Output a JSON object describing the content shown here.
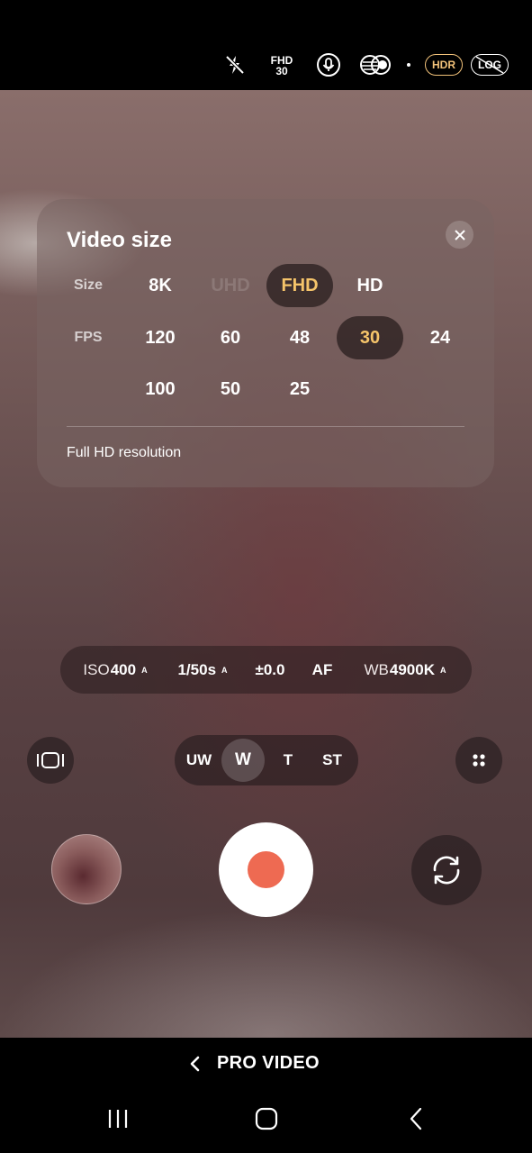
{
  "status_bar": {
    "flash_icon": "flash-off-icon",
    "resolution_badge": {
      "size": "FHD",
      "fps": "30"
    },
    "mic_icon": "microphone-icon",
    "filter_icon": "filter-icon",
    "hdr_label": "HDR",
    "log_label": "LOG"
  },
  "video_size_panel": {
    "title": "Video size",
    "size_label": "Size",
    "fps_label": "FPS",
    "sizes": [
      {
        "label": "8K",
        "state": "normal"
      },
      {
        "label": "UHD",
        "state": "disabled"
      },
      {
        "label": "FHD",
        "state": "selected"
      },
      {
        "label": "HD",
        "state": "normal"
      }
    ],
    "fps_row1": [
      {
        "label": "120",
        "state": "normal"
      },
      {
        "label": "60",
        "state": "normal"
      },
      {
        "label": "48",
        "state": "normal"
      },
      {
        "label": "30",
        "state": "selected"
      },
      {
        "label": "24",
        "state": "normal"
      }
    ],
    "fps_row2": [
      {
        "label": "100",
        "state": "normal"
      },
      {
        "label": "50",
        "state": "normal"
      },
      {
        "label": "25",
        "state": "normal"
      }
    ],
    "description": "Full HD resolution",
    "close_icon": "close-icon"
  },
  "pro_settings": {
    "iso_key": "ISO",
    "iso_value": "400",
    "iso_auto": "A",
    "shutter_value": "1/50s",
    "shutter_auto": "A",
    "ev_value": "±0.0",
    "focus_value": "AF",
    "wb_key": "WB",
    "wb_value": "4900K",
    "wb_auto": "A"
  },
  "lens_row": {
    "aspect_icon": "aspect-ratio-icon",
    "lenses": [
      "UW",
      "W",
      "T",
      "ST"
    ],
    "active_lens": "W",
    "more_icon": "more-options-icon"
  },
  "capture_row": {
    "gallery_icon": "gallery-thumbnail",
    "record_color": "#ee6a52",
    "switch_icon": "switch-camera-icon"
  },
  "mode": {
    "label": "PRO VIDEO",
    "back_icon": "chevron-left-icon"
  },
  "nav": {
    "recents": "recents-icon",
    "home": "home-icon",
    "back": "back-icon"
  },
  "colors": {
    "accent": "#f5c46a",
    "hdr": "#f2c27a",
    "record": "#ee6a52"
  }
}
